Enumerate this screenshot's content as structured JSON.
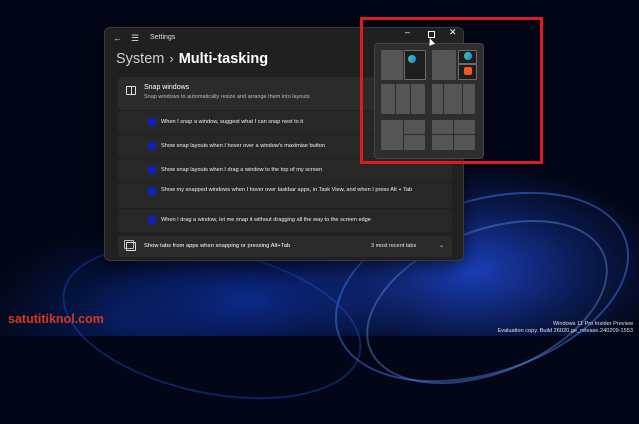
{
  "settings_window": {
    "app_title": "Settings",
    "breadcrumb": {
      "parent": "System",
      "separator": "›",
      "current": "Multi-tasking"
    },
    "snap_windows": {
      "title": "Snap windows",
      "description": "Snap windows to automatically resize and arrange them into layouts",
      "options": [
        {
          "label": "When I snap a window, suggest what I can snap next to it",
          "checked": true
        },
        {
          "label": "Show snap layouts when I hover over a window's maximise button",
          "checked": true
        },
        {
          "label": "Show snap layouts when I drag a window to the top of my screen",
          "checked": true
        },
        {
          "label": "Show my snapped windows when I hover over taskbar apps, in Task View, and when I press Alt + Tab",
          "checked": true
        },
        {
          "label": "When I drag a window, let me snap it without dragging all the way to the screen edge",
          "checked": true
        }
      ]
    },
    "tabs_setting": {
      "label": "Show tabs from apps when snapping or pressing Alt+Tab",
      "selected": "3 most recent tabs"
    }
  },
  "caption_buttons": {
    "minimize": "–",
    "close": "✕"
  },
  "watermark": "satutitiknol.com",
  "desktop_info": {
    "line1": "Windows 11 Pro Insider Preview",
    "line2": "Evaluation copy. Build 26020.ge_release.240209-1553"
  },
  "colors": {
    "checkbox": "#0f1fb8",
    "highlight": "#e01a22",
    "watermark": "#d9371b"
  },
  "icons": [
    "back-arrow-icon",
    "menu-icon",
    "snap-window-icon",
    "tabs-icon",
    "chevron-down-icon",
    "edge-icon",
    "brave-icon"
  ]
}
